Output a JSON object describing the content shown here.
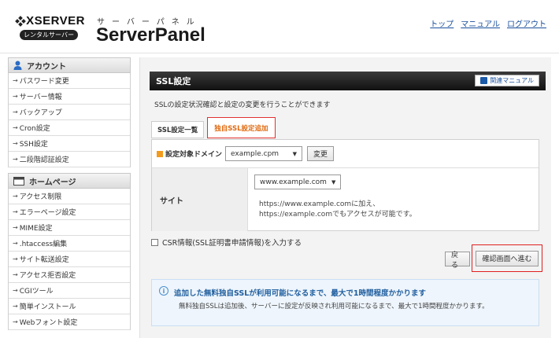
{
  "header": {
    "logo_text": "XSERVER",
    "logo_badge": "レンタルサーバー",
    "panel_kana": "サーバーパネル",
    "panel_title": "ServerPanel",
    "nav": [
      "トップ",
      "マニュアル",
      "ログアウト"
    ]
  },
  "sidebar": {
    "account": {
      "title": "アカウント",
      "items": [
        "パスワード変更",
        "サーバー情報",
        "バックアップ",
        "Cron設定",
        "SSH設定",
        "二段階認証設定"
      ]
    },
    "homepage": {
      "title": "ホームページ",
      "items": [
        "アクセス制限",
        "エラーページ設定",
        "MIME設定",
        ".htaccess編集",
        "サイト転送設定",
        "アクセス拒否設定",
        "CGIツール",
        "簡単インストール",
        "Webフォント設定"
      ]
    }
  },
  "main": {
    "title": "SSL設定",
    "manual_label": "関連マニュアル",
    "description": "SSLの設定状況確認と設定の変更を行うことができます",
    "tabs": [
      {
        "label": "SSL設定一覧",
        "active": false
      },
      {
        "label": "独自SSL設定追加",
        "active": true
      }
    ],
    "form": {
      "domain_label": "設定対象ドメイン",
      "domain_value": "example.cpm",
      "change_button": "変更",
      "site_label": "サイト",
      "site_value": "www.example.com",
      "site_note_1": "https://www.example.comに加え、",
      "site_note_2": "https://example.comでもアクセスが可能です。"
    },
    "csr_label": "CSR情報(SSL証明書申請情報)を入力する",
    "back_button": "戻る",
    "confirm_button": "確認画面へ進む",
    "info": {
      "title": "追加した無料独自SSLが利用可能になるまで、最大で1時間程度かかります",
      "body": "無料独自SSLは追加後、サーバーに設定が反映され利用可能になるまで、最大で1時間程度かかります。"
    }
  },
  "colors": {
    "accent_orange": "#e06a10",
    "highlight_red": "#e02020",
    "link_blue": "#1a4f9c",
    "title_bar": "#111111"
  }
}
